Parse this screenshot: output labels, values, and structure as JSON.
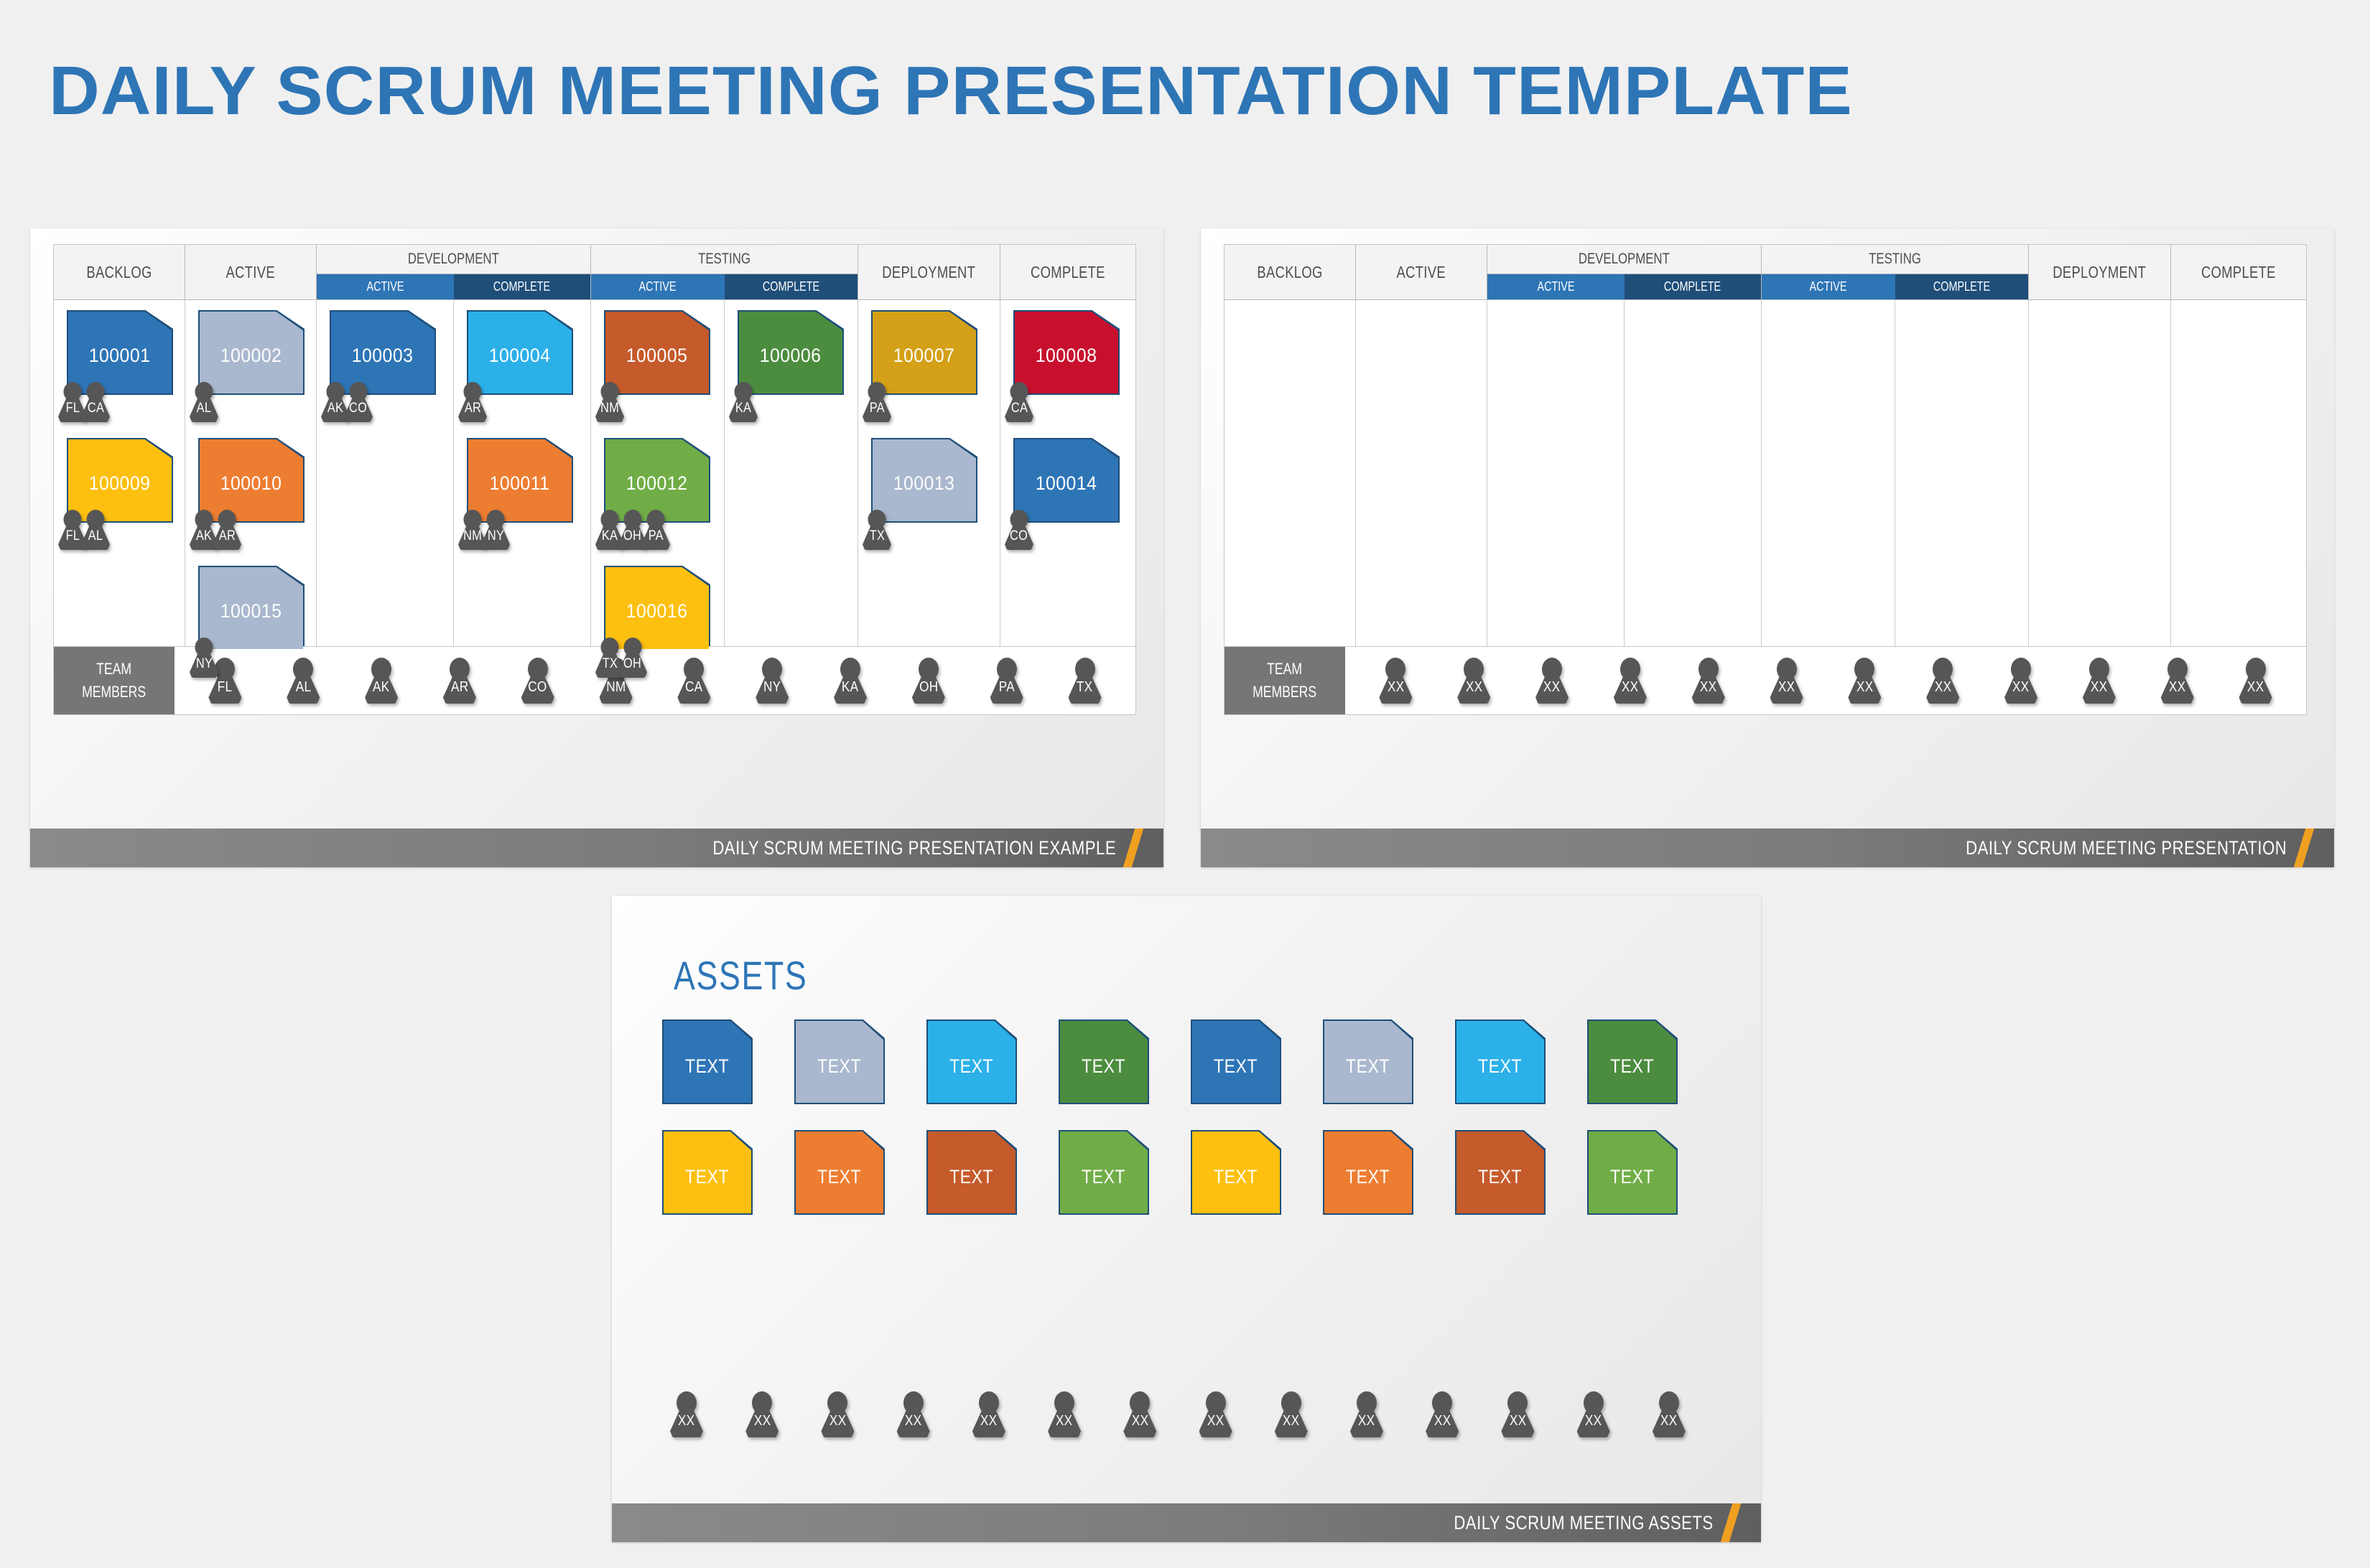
{
  "page_title": "DAILY SCRUM MEETING PRESENTATION TEMPLATE",
  "colors": {
    "accent_blue": "#2e75b6",
    "header_active": "#2e75b6",
    "header_complete": "#1f4e79",
    "footer_gray": "#7b7b7b",
    "footer_slash": "#f0a020",
    "avatar_gray": "#565656",
    "team_label_bg": "#767676"
  },
  "board_headers": {
    "backlog": "BACKLOG",
    "active": "ACTIVE",
    "development": "DEVELOPMENT",
    "testing": "TESTING",
    "deployment": "DEPLOYMENT",
    "complete": "COMPLETE",
    "sub_active": "ACTIVE",
    "sub_complete": "COMPLETE"
  },
  "team_label_line1": "TEAM",
  "team_label_line2": "MEMBERS",
  "example_slide": {
    "footer_text": "DAILY SCRUM MEETING PRESENTATION EXAMPLE",
    "team_members": [
      "FL",
      "AL",
      "AK",
      "AR",
      "CO",
      "NM",
      "CA",
      "NY",
      "KA",
      "OH",
      "PA",
      "TX"
    ],
    "columns": [
      {
        "key": "backlog",
        "cards": [
          {
            "id": "100001",
            "color": "#2e75b6",
            "members": [
              "FL",
              "CA"
            ]
          },
          {
            "id": "100009",
            "color": "#fdc010",
            "members": [
              "FL",
              "AL"
            ]
          }
        ]
      },
      {
        "key": "active",
        "cards": [
          {
            "id": "100002",
            "color": "#a9b8ce",
            "members": [
              "AL"
            ]
          },
          {
            "id": "100010",
            "color": "#ed7d31",
            "members": [
              "AK",
              "AR"
            ]
          },
          {
            "id": "100015",
            "color": "#a9b8ce",
            "members": [
              "NY"
            ]
          }
        ]
      },
      {
        "key": "development_active",
        "cards": [
          {
            "id": "100003",
            "color": "#2e75b6",
            "members": [
              "AK",
              "CO"
            ]
          }
        ]
      },
      {
        "key": "development_complete",
        "cards": [
          {
            "id": "100004",
            "color": "#2bb0e8",
            "members": [
              "AR"
            ]
          },
          {
            "id": "100011",
            "color": "#ed7d31",
            "members": [
              "NM",
              "NY"
            ]
          }
        ]
      },
      {
        "key": "testing_active",
        "cards": [
          {
            "id": "100005",
            "color": "#c55a2b",
            "members": [
              "NM"
            ]
          },
          {
            "id": "100012",
            "color": "#70ad47",
            "members": [
              "KA",
              "OH",
              "PA"
            ]
          },
          {
            "id": "100016",
            "color": "#fdc010",
            "members": [
              "TX",
              "OH"
            ]
          }
        ]
      },
      {
        "key": "testing_complete",
        "cards": [
          {
            "id": "100006",
            "color": "#4c8c3f",
            "members": [
              "KA"
            ]
          }
        ]
      },
      {
        "key": "deployment",
        "cards": [
          {
            "id": "100007",
            "color": "#d4a017",
            "members": [
              "PA"
            ]
          },
          {
            "id": "100013",
            "color": "#a9b8ce",
            "members": [
              "TX"
            ]
          }
        ]
      },
      {
        "key": "complete",
        "cards": [
          {
            "id": "100008",
            "color": "#c8102e",
            "members": [
              "CA"
            ]
          },
          {
            "id": "100014",
            "color": "#2e75b6",
            "members": [
              "CO"
            ]
          }
        ]
      }
    ]
  },
  "blank_slide": {
    "footer_text": "DAILY SCRUM MEETING PRESENTATION",
    "team_member_placeholder": "XX",
    "team_member_count": 12
  },
  "assets_slide": {
    "title": "ASSETS",
    "footer_text": "DAILY SCRUM MEETING ASSETS",
    "swatch_label": "TEXT",
    "rows": [
      [
        "#2e75b6",
        "#a9b8ce",
        "#2bb0e8",
        "#4c8c3f",
        "#2e75b6",
        "#a9b8ce",
        "#2bb0e8",
        "#4c8c3f"
      ],
      [
        "#fdc010",
        "#ed7d31",
        "#c55a2b",
        "#70ad47",
        "#fdc010",
        "#ed7d31",
        "#c55a2b",
        "#70ad47"
      ]
    ],
    "team_member_placeholder": "XX",
    "team_member_count": 14
  }
}
